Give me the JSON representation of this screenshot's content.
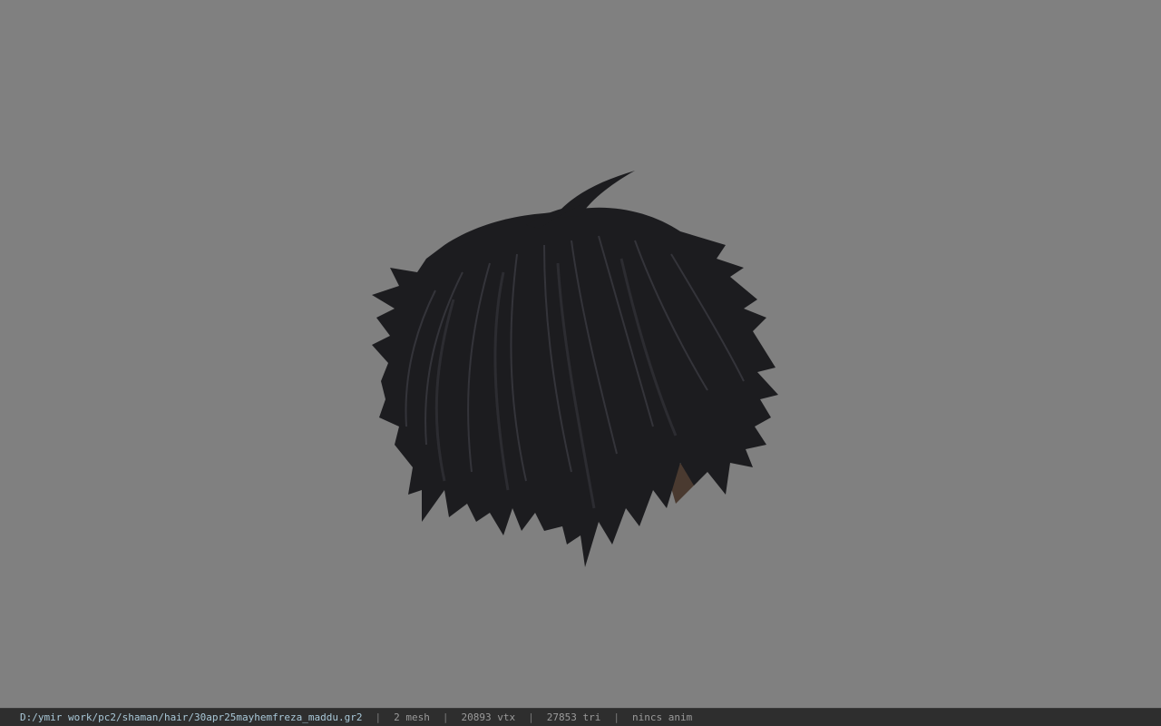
{
  "status": {
    "file_path": "D:/ymir work/pc2/shaman/hair/30apr25mayhemfreza_maddu.gr2",
    "separator": "|",
    "mesh_count": "2 mesh",
    "vertex_count": "20893 vtx",
    "triangle_count": "27853 tri",
    "animation": "nincs anim"
  },
  "colors": {
    "background": "#808080",
    "status_bar": "#2e2e2e",
    "hair_dark": "#1a1a1c",
    "hair_mid": "#2a2a2e",
    "hair_highlight": "#3a3a40",
    "skin_hint": "#4a3a30"
  },
  "model": {
    "icon": "hair-mesh-model"
  }
}
